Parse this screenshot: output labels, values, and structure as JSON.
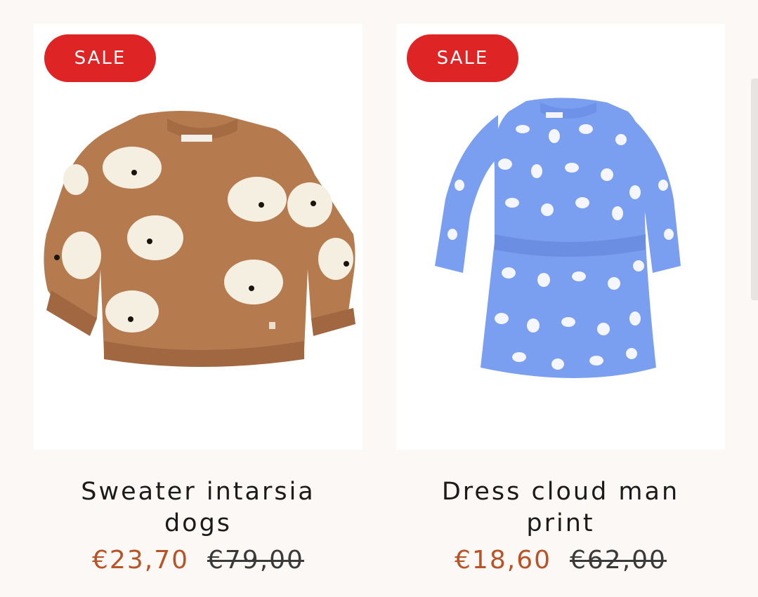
{
  "products": [
    {
      "badge": "SALE",
      "title": "Sweater intarsia dogs",
      "sale_price": "€23,70",
      "regular_price": "€79,00",
      "image_icon": "brown-knit-sweater-with-dogs",
      "color": "#b57b4f"
    },
    {
      "badge": "SALE",
      "title": "Dress cloud man print",
      "sale_price": "€18,60",
      "regular_price": "€62,00",
      "image_icon": "blue-dress-with-clouds",
      "color": "#7a9ef0"
    }
  ],
  "colors": {
    "badge_bg": "#df2426",
    "sale_price": "#b85227",
    "page_bg": "#fcf8f5"
  }
}
